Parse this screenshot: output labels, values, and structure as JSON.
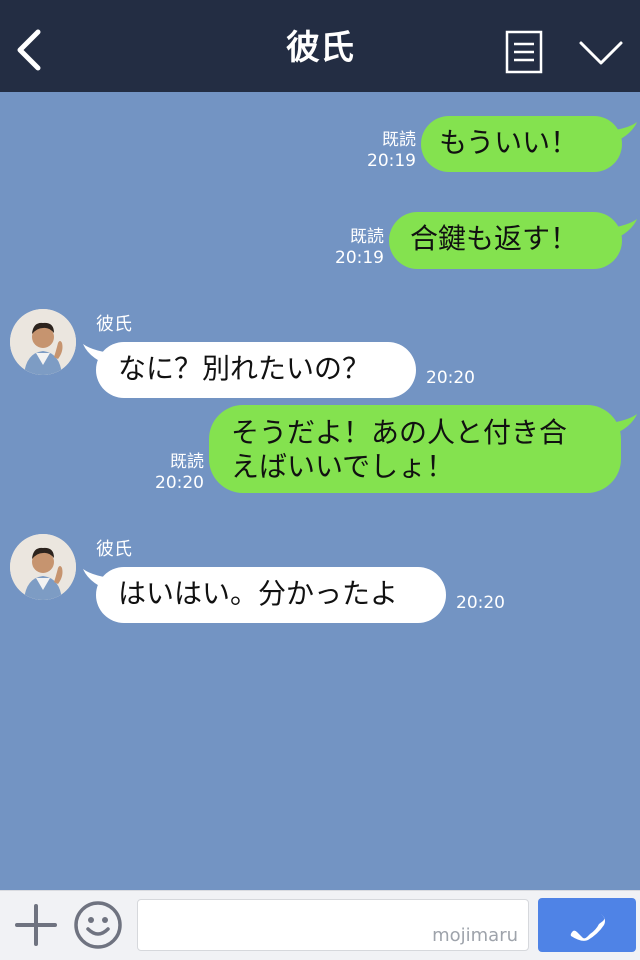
{
  "header": {
    "title": "彼氏"
  },
  "messages": [
    {
      "text": "もういい！",
      "read": "既読",
      "time": "20:19"
    },
    {
      "text": "合鍵も返す！",
      "read": "既読",
      "time": "20:19"
    },
    {
      "sender": "彼氏",
      "text": "なに？別れたいの？",
      "time": "20:20"
    },
    {
      "line1": "そうだよ！あの人と付き合",
      "line2": "えばいいでしょ！",
      "read": "既読",
      "time": "20:20"
    },
    {
      "sender": "彼氏",
      "text": "はいはい。分かったよ",
      "time": "20:20"
    }
  ],
  "input": {
    "placeholder": "",
    "watermark": "mojimaru"
  },
  "colors": {
    "header_bg": "#232d43",
    "chat_bg": "#7394c3",
    "outgoing_bubble": "#84e24f",
    "incoming_bubble": "#ffffff",
    "call_button": "#4f83e6"
  },
  "icons": {
    "back": "chevron-left-icon",
    "menu": "document-list-icon",
    "collapse": "chevron-down-icon",
    "add": "plus-icon",
    "emoji": "smiley-icon",
    "call": "phone-icon"
  }
}
